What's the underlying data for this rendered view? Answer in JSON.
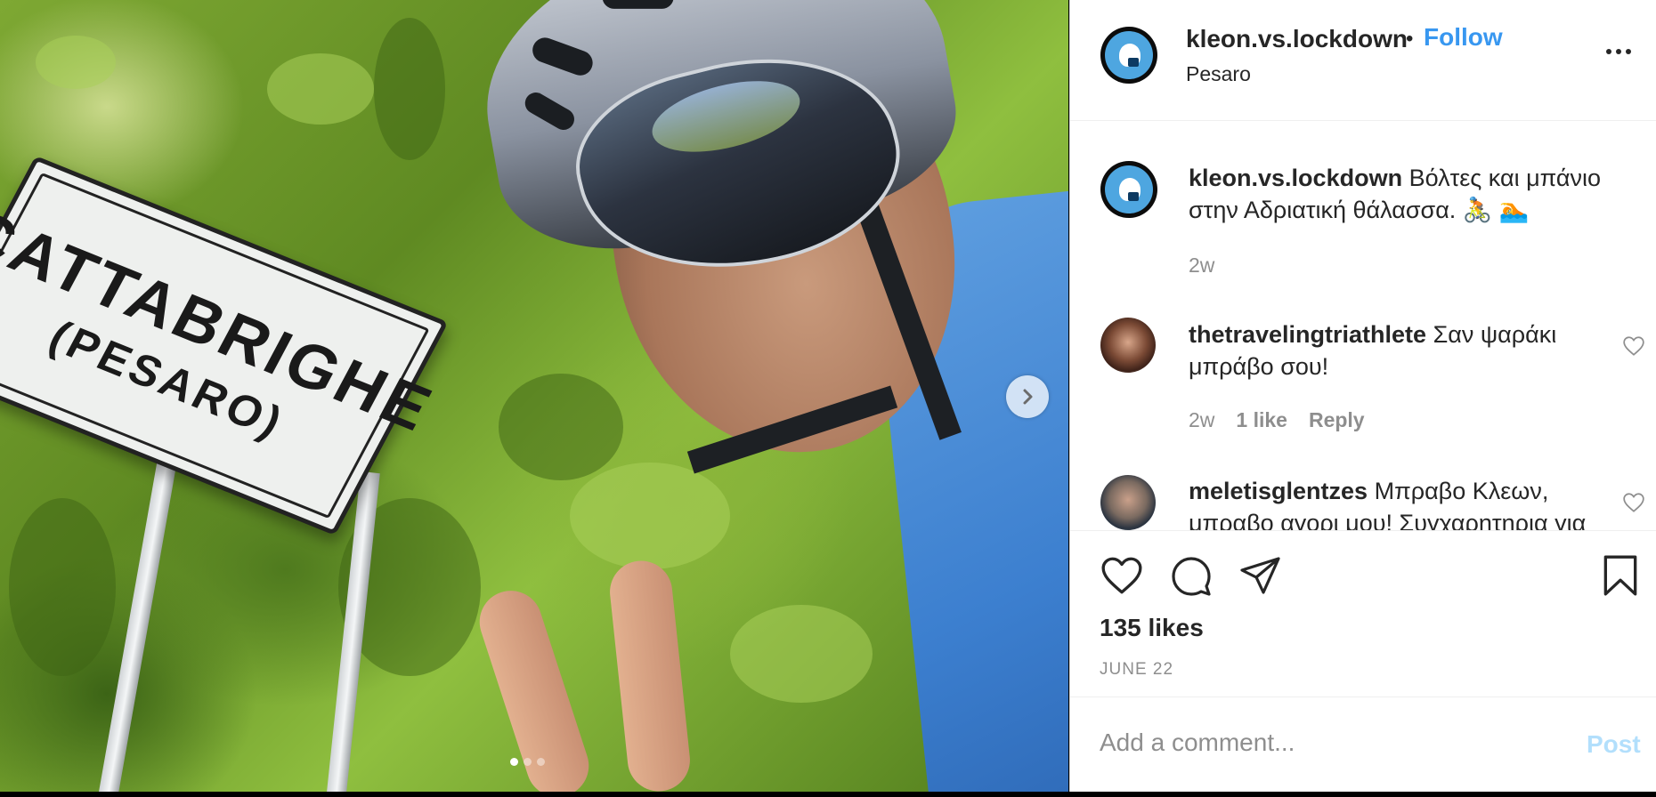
{
  "photo": {
    "sign_line1": "CATTABRIGHE",
    "sign_line2": "(PESARO)",
    "carousel": {
      "total": 3,
      "active": 1,
      "next_icon": "chevron-right-icon"
    }
  },
  "header": {
    "username": "kleon.vs.lockdown",
    "separator": "•",
    "follow_label": "Follow",
    "location": "Pesaro",
    "more_icon": "more-horizontal-icon"
  },
  "caption": {
    "username": "kleon.vs.lockdown",
    "text": "Βόλτες και μπάνιο στην Αδριατική θάλασσα. 🚴 🏊",
    "time": "2w"
  },
  "comments": [
    {
      "username": "thetravelingtriathlete",
      "text": "Σαν ψαράκι μπράβο σου!",
      "time": "2w",
      "likes": "1 like",
      "reply": "Reply"
    },
    {
      "username": "meletisglentzes",
      "text": "Μπραβο Κλεων, μπραβο αγορι μου! Συγχαρητηρια για"
    }
  ],
  "actions": {
    "likes_count": "135 likes",
    "date": "JUNE 22"
  },
  "add_comment": {
    "placeholder": "Add a comment...",
    "post_label": "Post"
  },
  "colors": {
    "accent": "#3897f0",
    "post_disabled": "#b2dffc",
    "text": "#262626",
    "muted": "#8e8e8e"
  }
}
